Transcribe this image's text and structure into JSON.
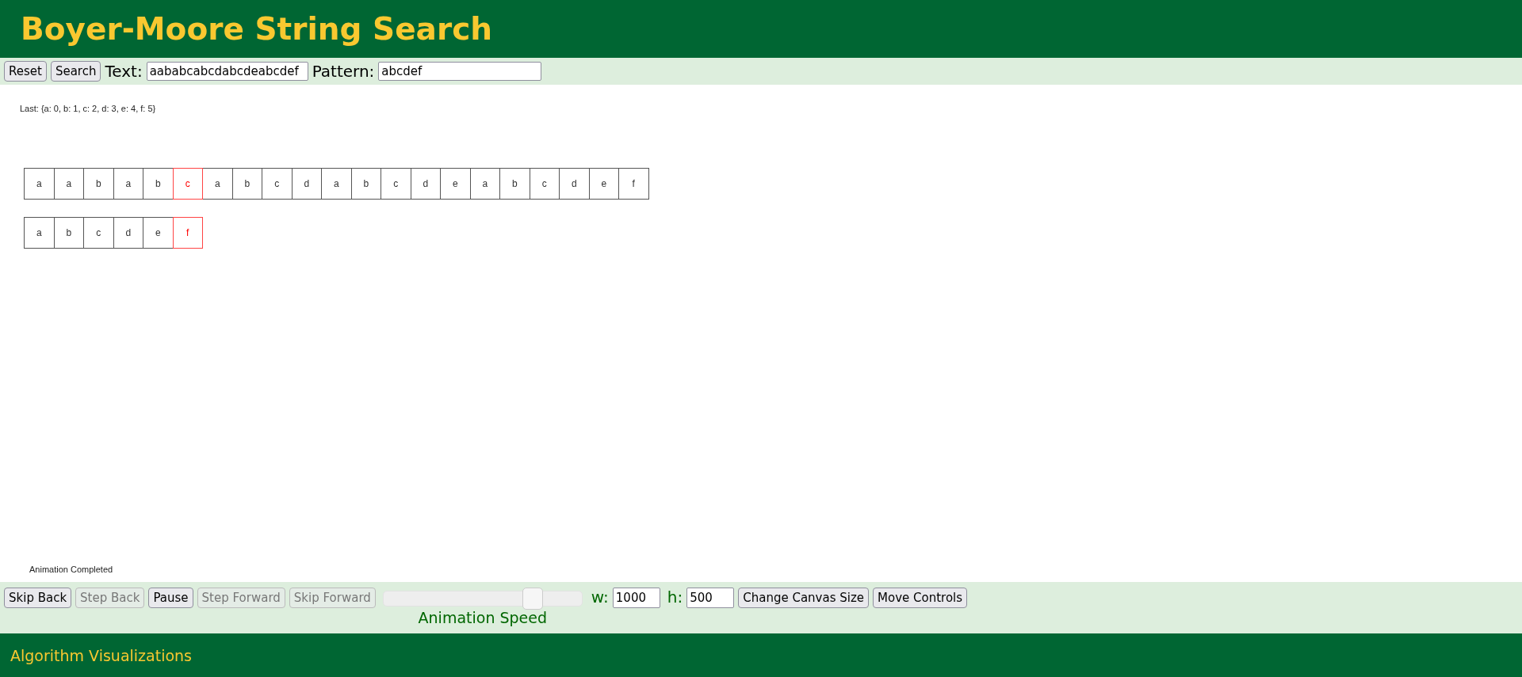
{
  "header": {
    "title": "Boyer-Moore String Search"
  },
  "toolbar": {
    "buttons": [
      {
        "label": "Reset",
        "disabled": false
      },
      {
        "label": "Search",
        "disabled": false
      }
    ],
    "fields": [
      {
        "label": "Text:",
        "value": "aababcabcdabcdeabcdef",
        "kind": "wide"
      },
      {
        "label": "Pattern:",
        "value": "abcdef",
        "kind": "wide"
      }
    ]
  },
  "canvas": {
    "last_table": "Last: {a: 0, b: 1, c: 2, d: 3, e: 4, f: 5}",
    "rows": [
      {
        "cells": [
          {
            "char": "a",
            "highlighted": false
          },
          {
            "char": "a",
            "highlighted": false
          },
          {
            "char": "b",
            "highlighted": false
          },
          {
            "char": "a",
            "highlighted": false
          },
          {
            "char": "b",
            "highlighted": false
          },
          {
            "char": "c",
            "highlighted": true
          },
          {
            "char": "a",
            "highlighted": false
          },
          {
            "char": "b",
            "highlighted": false
          },
          {
            "char": "c",
            "highlighted": false
          },
          {
            "char": "d",
            "highlighted": false
          },
          {
            "char": "a",
            "highlighted": false
          },
          {
            "char": "b",
            "highlighted": false
          },
          {
            "char": "c",
            "highlighted": false
          },
          {
            "char": "d",
            "highlighted": false
          },
          {
            "char": "e",
            "highlighted": false
          },
          {
            "char": "a",
            "highlighted": false
          },
          {
            "char": "b",
            "highlighted": false
          },
          {
            "char": "c",
            "highlighted": false
          },
          {
            "char": "d",
            "highlighted": false
          },
          {
            "char": "e",
            "highlighted": false
          },
          {
            "char": "f",
            "highlighted": false
          }
        ]
      },
      {
        "cells": [
          {
            "char": "a",
            "highlighted": false
          },
          {
            "char": "b",
            "highlighted": false
          },
          {
            "char": "c",
            "highlighted": false
          },
          {
            "char": "d",
            "highlighted": false
          },
          {
            "char": "e",
            "highlighted": false
          },
          {
            "char": "f",
            "highlighted": true
          }
        ]
      }
    ],
    "status": "Animation Completed"
  },
  "controls": {
    "buttons": [
      {
        "label": "Skip Back",
        "disabled": false
      },
      {
        "label": "Step Back",
        "disabled": true
      },
      {
        "label": "Pause",
        "disabled": false
      },
      {
        "label": "Step Forward",
        "disabled": true
      },
      {
        "label": "Skip Forward",
        "disabled": true
      }
    ],
    "speed": {
      "level": 0.78,
      "label": "Animation Speed"
    },
    "size_fields": [
      {
        "label": "w:",
        "value": "1000"
      },
      {
        "label": "h:",
        "value": "500"
      }
    ],
    "size_buttons": [
      {
        "label": "Change Canvas Size",
        "disabled": false
      },
      {
        "label": "Move Controls",
        "disabled": false
      }
    ]
  },
  "footer": {
    "text": "Algorithm Visualizations"
  }
}
